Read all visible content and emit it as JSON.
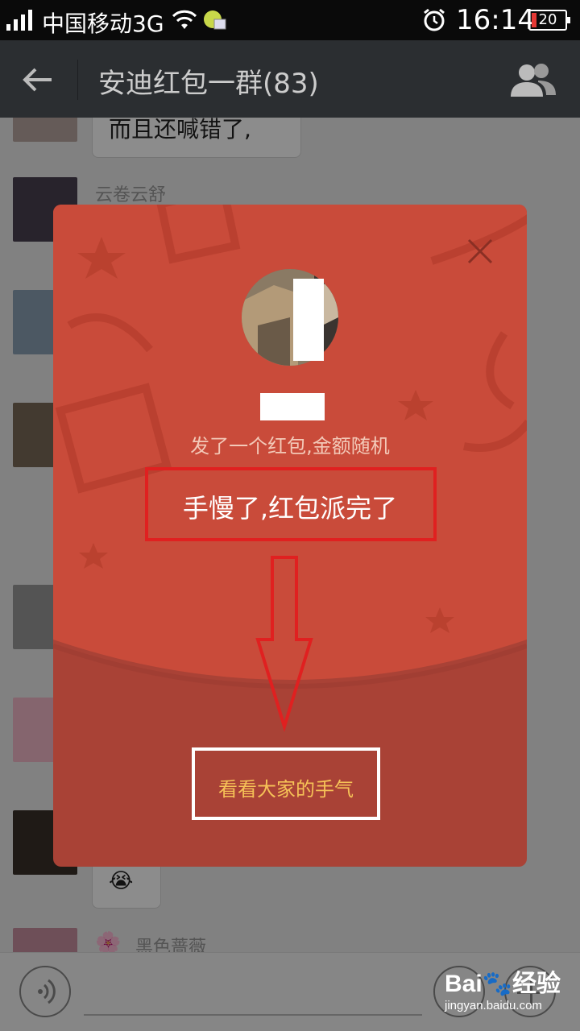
{
  "status_bar": {
    "carrier": "中国移动3G",
    "time": "16:14",
    "battery": "20"
  },
  "header": {
    "title": "安迪红包一群(83)"
  },
  "chat": {
    "messages": [
      {
        "text": "而且还喊错了,"
      },
      {
        "sender": "云卷云舒"
      },
      {
        "sender": "黑色蔷薇"
      }
    ]
  },
  "red_packet": {
    "subtitle": "发了一个红包,金额随机",
    "message": "手慢了,红包派完了",
    "link": "看看大家的手气",
    "colors": {
      "top": "#c94b3a",
      "bottom": "#a94236",
      "link": "#f6c257",
      "highlight": "#e02020"
    }
  },
  "watermark": {
    "brand": "Bai🐾经验",
    "url": "jingyan.baidu.com"
  }
}
